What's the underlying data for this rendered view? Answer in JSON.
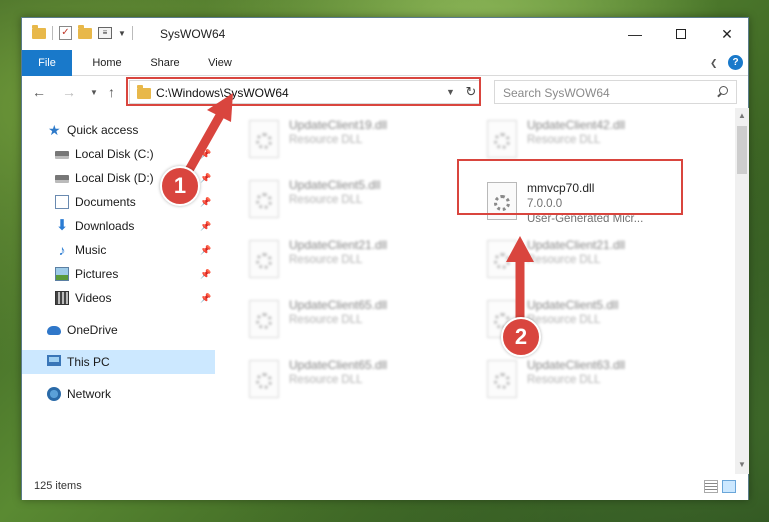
{
  "window": {
    "title": "SysWOW64",
    "minimize_glyph": "—",
    "close_glyph": "✕"
  },
  "ribbon": {
    "tabs": [
      "File",
      "Home",
      "Share",
      "View"
    ]
  },
  "address_bar": {
    "path": "C:\\Windows\\SysWOW64"
  },
  "search": {
    "placeholder": "Search SysWOW64"
  },
  "sidebar": {
    "items": [
      {
        "label": "Quick access",
        "icon": "star-icon"
      },
      {
        "label": "Local Disk (C:)",
        "icon": "disk-icon"
      },
      {
        "label": "Local Disk (D:)",
        "icon": "disk-icon"
      },
      {
        "label": "Documents",
        "icon": "documents-icon"
      },
      {
        "label": "Downloads",
        "icon": "downloads-icon"
      },
      {
        "label": "Music",
        "icon": "music-icon"
      },
      {
        "label": "Pictures",
        "icon": "pictures-icon"
      },
      {
        "label": "Videos",
        "icon": "videos-icon"
      },
      {
        "label": "OneDrive",
        "icon": "onedrive-icon"
      },
      {
        "label": "This PC",
        "icon": "pc-icon"
      },
      {
        "label": "Network",
        "icon": "network-icon"
      }
    ],
    "selected": "This PC"
  },
  "files": [
    {
      "name": "UpdateClient19.dll",
      "desc": "Resource DLL"
    },
    {
      "name": "UpdateClient42.dll",
      "desc": "Resource DLL"
    },
    {
      "name": "UpdateClient5.dll",
      "desc": "Resource DLL"
    },
    {
      "name": "mmvcp70.dll",
      "desc": "7.0.0.0",
      "desc2": "User-Generated Micr..."
    },
    {
      "name": "UpdateClient21.dll",
      "desc": "Resource DLL"
    },
    {
      "name": "UpdateClient21.dll",
      "desc": "Resource DLL"
    },
    {
      "name": "UpdateClient65.dll",
      "desc": "Resource DLL"
    },
    {
      "name": "UpdateClient5.dll",
      "desc": "Resource DLL"
    },
    {
      "name": "UpdateClient65.dll",
      "desc": "Resource DLL"
    },
    {
      "name": "UpdateClient63.dll",
      "desc": "Resource DLL"
    }
  ],
  "status": {
    "item_count": "125 items"
  },
  "annotations": {
    "step1": "1",
    "step2": "2",
    "color": "#d9453e"
  }
}
